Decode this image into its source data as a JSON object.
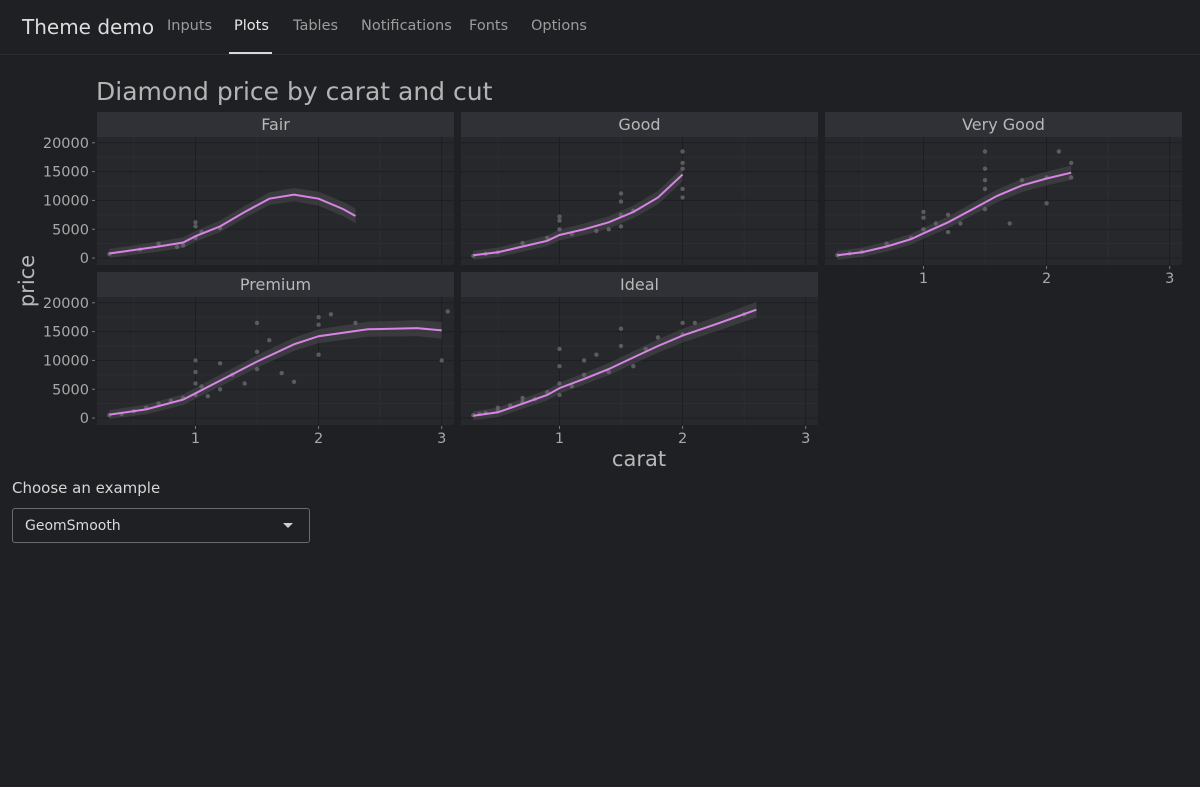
{
  "navbar": {
    "brand": "Theme demo",
    "tabs": [
      {
        "label": "Inputs"
      },
      {
        "label": "Plots",
        "active": true
      },
      {
        "label": "Tables"
      },
      {
        "label": "Notifications"
      },
      {
        "label": "Fonts"
      },
      {
        "label": "Options"
      }
    ]
  },
  "example_select": {
    "label": "Choose an example",
    "value": "GeomSmooth"
  },
  "colors": {
    "background": "#1f2023",
    "panel": "#27282c",
    "strip": "#303136",
    "smooth_line": "#d884e6",
    "points": "#6d6d72"
  },
  "chart_data": {
    "type": "scatter",
    "title": "Diamond price by carat and cut",
    "xlabel": "carat",
    "ylabel": "price",
    "xlim": [
      0.2,
      3.1
    ],
    "ylim": [
      -1200,
      21000
    ],
    "xticks": [
      1,
      2,
      3
    ],
    "yticks": [
      0,
      5000,
      10000,
      15000,
      20000
    ],
    "grid": true,
    "facets": [
      {
        "name": "Fair",
        "smooth": [
          [
            0.3,
            800
          ],
          [
            0.5,
            1400
          ],
          [
            0.7,
            2000
          ],
          [
            0.9,
            2700
          ],
          [
            1.0,
            3800
          ],
          [
            1.2,
            5500
          ],
          [
            1.4,
            8000
          ],
          [
            1.6,
            10300
          ],
          [
            1.8,
            11000
          ],
          [
            2.0,
            10300
          ],
          [
            2.2,
            8500
          ],
          [
            2.3,
            7300
          ]
        ],
        "points": [
          [
            0.3,
            700
          ],
          [
            0.55,
            1500
          ],
          [
            0.7,
            2500
          ],
          [
            0.9,
            2200
          ],
          [
            1.0,
            3500
          ],
          [
            1.0,
            5500
          ],
          [
            1.0,
            6200
          ],
          [
            1.05,
            4500
          ],
          [
            1.2,
            5200
          ],
          [
            0.85,
            1900
          ]
        ]
      },
      {
        "name": "Good",
        "smooth": [
          [
            0.3,
            500
          ],
          [
            0.5,
            1000
          ],
          [
            0.7,
            2000
          ],
          [
            0.9,
            3000
          ],
          [
            1.0,
            4000
          ],
          [
            1.2,
            5000
          ],
          [
            1.4,
            6200
          ],
          [
            1.6,
            8000
          ],
          [
            1.8,
            10500
          ],
          [
            2.0,
            14500
          ]
        ],
        "points": [
          [
            0.3,
            400
          ],
          [
            0.4,
            700
          ],
          [
            0.5,
            1000
          ],
          [
            0.7,
            2600
          ],
          [
            0.9,
            3500
          ],
          [
            1.0,
            5000
          ],
          [
            1.0,
            6500
          ],
          [
            1.0,
            7200
          ],
          [
            1.1,
            4200
          ],
          [
            1.3,
            4700
          ],
          [
            1.4,
            5000
          ],
          [
            1.5,
            5500
          ],
          [
            1.5,
            7500
          ],
          [
            1.5,
            9800
          ],
          [
            1.5,
            11200
          ],
          [
            1.6,
            8200
          ],
          [
            2.0,
            10500
          ],
          [
            2.0,
            12000
          ],
          [
            2.0,
            15500
          ],
          [
            2.0,
            16500
          ],
          [
            2.0,
            18500
          ]
        ]
      },
      {
        "name": "Very Good",
        "smooth": [
          [
            0.3,
            500
          ],
          [
            0.5,
            1000
          ],
          [
            0.7,
            2000
          ],
          [
            0.9,
            3300
          ],
          [
            1.0,
            4300
          ],
          [
            1.2,
            6200
          ],
          [
            1.4,
            8500
          ],
          [
            1.6,
            10800
          ],
          [
            1.8,
            12600
          ],
          [
            2.0,
            13800
          ],
          [
            2.2,
            14800
          ]
        ],
        "points": [
          [
            0.3,
            500
          ],
          [
            0.4,
            800
          ],
          [
            0.5,
            1100
          ],
          [
            0.7,
            2500
          ],
          [
            0.9,
            3500
          ],
          [
            1.0,
            5000
          ],
          [
            1.0,
            7000
          ],
          [
            1.0,
            8000
          ],
          [
            1.1,
            6000
          ],
          [
            1.2,
            4500
          ],
          [
            1.2,
            7500
          ],
          [
            1.3,
            6000
          ],
          [
            1.5,
            8500
          ],
          [
            1.5,
            12000
          ],
          [
            1.5,
            13500
          ],
          [
            1.5,
            15500
          ],
          [
            1.5,
            18500
          ],
          [
            1.7,
            6000
          ],
          [
            1.8,
            13500
          ],
          [
            2.0,
            9500
          ],
          [
            2.0,
            14000
          ],
          [
            2.1,
            18500
          ],
          [
            2.2,
            16500
          ],
          [
            2.2,
            14000
          ]
        ]
      },
      {
        "name": "Premium",
        "smooth": [
          [
            0.3,
            600
          ],
          [
            0.6,
            1500
          ],
          [
            0.9,
            3200
          ],
          [
            1.0,
            4300
          ],
          [
            1.2,
            6500
          ],
          [
            1.5,
            9800
          ],
          [
            1.8,
            12800
          ],
          [
            2.0,
            14200
          ],
          [
            2.4,
            15400
          ],
          [
            2.8,
            15600
          ],
          [
            3.0,
            15200
          ]
        ],
        "points": [
          [
            0.3,
            500
          ],
          [
            0.4,
            700
          ],
          [
            0.5,
            1200
          ],
          [
            0.6,
            1800
          ],
          [
            0.7,
            2500
          ],
          [
            0.8,
            3000
          ],
          [
            0.9,
            3500
          ],
          [
            1.0,
            4000
          ],
          [
            1.0,
            6000
          ],
          [
            1.0,
            8000
          ],
          [
            1.0,
            10000
          ],
          [
            1.05,
            5500
          ],
          [
            1.1,
            3800
          ],
          [
            1.2,
            5000
          ],
          [
            1.2,
            9500
          ],
          [
            1.3,
            7500
          ],
          [
            1.4,
            6000
          ],
          [
            1.5,
            8500
          ],
          [
            1.5,
            11500
          ],
          [
            1.5,
            16500
          ],
          [
            1.6,
            13500
          ],
          [
            1.7,
            7800
          ],
          [
            1.8,
            6300
          ],
          [
            2.0,
            11000
          ],
          [
            2.0,
            16200
          ],
          [
            2.0,
            17500
          ],
          [
            2.1,
            18000
          ],
          [
            2.3,
            16500
          ],
          [
            3.0,
            10000
          ],
          [
            3.05,
            18500
          ]
        ]
      },
      {
        "name": "Ideal",
        "smooth": [
          [
            0.3,
            400
          ],
          [
            0.5,
            1000
          ],
          [
            0.7,
            2500
          ],
          [
            0.9,
            4000
          ],
          [
            1.0,
            5200
          ],
          [
            1.2,
            6800
          ],
          [
            1.4,
            8500
          ],
          [
            1.6,
            10500
          ],
          [
            1.8,
            12500
          ],
          [
            2.0,
            14300
          ],
          [
            2.3,
            16500
          ],
          [
            2.6,
            18800
          ]
        ],
        "points": [
          [
            0.3,
            500
          ],
          [
            0.35,
            700
          ],
          [
            0.4,
            900
          ],
          [
            0.5,
            1200
          ],
          [
            0.5,
            1800
          ],
          [
            0.6,
            2200
          ],
          [
            0.7,
            2800
          ],
          [
            0.7,
            3500
          ],
          [
            0.8,
            3300
          ],
          [
            0.9,
            4500
          ],
          [
            1.0,
            4000
          ],
          [
            1.0,
            6000
          ],
          [
            1.0,
            9000
          ],
          [
            1.0,
            12000
          ],
          [
            1.1,
            5500
          ],
          [
            1.2,
            7500
          ],
          [
            1.2,
            10000
          ],
          [
            1.3,
            11000
          ],
          [
            1.4,
            8000
          ],
          [
            1.5,
            12500
          ],
          [
            1.5,
            15500
          ],
          [
            1.6,
            9000
          ],
          [
            1.7,
            12000
          ],
          [
            1.8,
            14000
          ],
          [
            2.0,
            14500
          ],
          [
            2.0,
            16500
          ],
          [
            2.1,
            16500
          ],
          [
            2.5,
            18000
          ]
        ]
      }
    ]
  }
}
